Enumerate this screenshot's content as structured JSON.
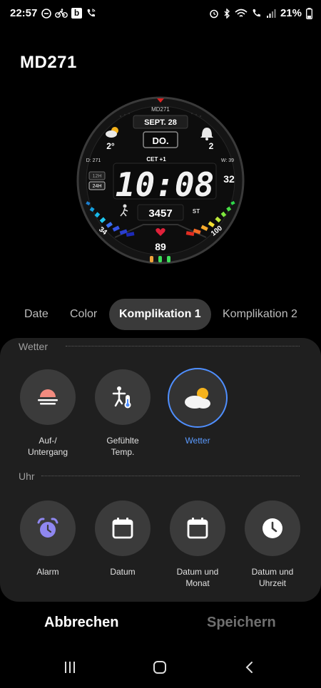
{
  "status_bar": {
    "time": "22:57",
    "battery": "21%",
    "icons_left": [
      "minus-circle-icon",
      "bike-icon",
      "b-app-icon",
      "wifi-call-icon"
    ],
    "icons_right": [
      "alarm-icon",
      "bluetooth-icon",
      "wifi-icon",
      "call-icon",
      "signal-icon",
      "battery-icon"
    ],
    "b_app_letter": "b"
  },
  "watch_title": "MD271",
  "watch_face": {
    "brand": "MD271",
    "date": "SEPT. 28",
    "weekday": "DO.",
    "temperature": "2°",
    "alarm_count": "2",
    "day_of_year": "D: 271",
    "timezone": "CET +1",
    "week": "W: 39",
    "format_12h": "12H",
    "format_24h": "24H",
    "time": "10:08",
    "seconds": "32",
    "steps": "3457",
    "steps_unit": "ST",
    "heart_rate": "89",
    "left_gauge": "34",
    "right_gauge": "100"
  },
  "tabs": [
    {
      "label": "Date",
      "active": false
    },
    {
      "label": "Color",
      "active": false
    },
    {
      "label": "Komplikation 1",
      "active": true
    },
    {
      "label": "Komplikation 2",
      "active": false
    }
  ],
  "sections": {
    "weather": {
      "title": "Wetter",
      "options": [
        {
          "label": "Auf-/\nUntergang",
          "icon": "sunrise-sunset-icon",
          "selected": false
        },
        {
          "label": "Gefühlte\nTemp.",
          "icon": "feels-like-temp-icon",
          "selected": false
        },
        {
          "label": "Wetter",
          "icon": "weather-icon",
          "selected": true
        }
      ]
    },
    "clock": {
      "title": "Uhr",
      "options": [
        {
          "label": "Alarm",
          "icon": "alarm-clock-icon",
          "selected": false
        },
        {
          "label": "Datum",
          "icon": "calendar-icon",
          "selected": false
        },
        {
          "label": "Datum und\nMonat",
          "icon": "calendar-month-icon",
          "selected": false
        },
        {
          "label": "Datum und\nUhrzeit",
          "icon": "clock-icon",
          "selected": false
        }
      ]
    }
  },
  "buttons": {
    "cancel": "Abbrechen",
    "save": "Speichern"
  },
  "colors": {
    "accent": "#4f8fff",
    "panel": "#1f1f1f",
    "background": "#000000"
  }
}
